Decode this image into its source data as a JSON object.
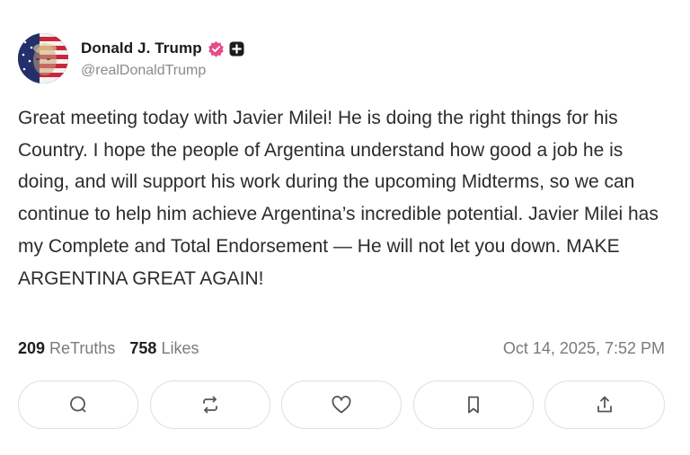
{
  "author": {
    "display_name": "Donald J. Trump",
    "handle": "@realDonaldTrump",
    "avatar_icon": "flag-portrait-avatar",
    "verified_icon": "verified-badge-icon",
    "verified_color": "#e84a8a",
    "extra_badge_icon": "plus-badge-icon"
  },
  "post": {
    "text": "Great meeting today with Javier Milei! He is doing the right things for his Country. I hope the people of Argentina understand how good a job he is doing, and will support his work during the upcoming Midterms, so we can continue to help him achieve Argentina’s incredible potential. Javier Milei has my Complete and Total Endorsement — He will not let you down. MAKE ARGENTINA GREAT AGAIN!"
  },
  "stats": {
    "retruths_count": "209",
    "retruths_label": "ReTruths",
    "likes_count": "758",
    "likes_label": "Likes",
    "timestamp": "Oct 14, 2025, 7:52 PM"
  },
  "actions": [
    {
      "name": "reply",
      "icon": "reply-bubble-icon"
    },
    {
      "name": "retruth",
      "icon": "repost-arrows-icon"
    },
    {
      "name": "like",
      "icon": "heart-icon"
    },
    {
      "name": "bookmark",
      "icon": "bookmark-icon"
    },
    {
      "name": "share",
      "icon": "share-upload-icon"
    }
  ]
}
